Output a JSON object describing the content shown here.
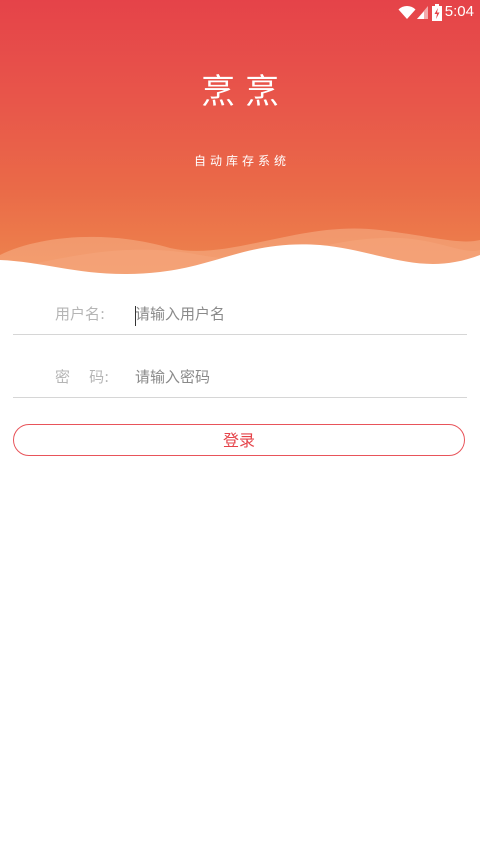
{
  "status_bar": {
    "time": "5:04",
    "icons": [
      "wifi-icon",
      "signal-icon",
      "battery-charging-icon"
    ]
  },
  "app": {
    "title": "烹烹",
    "subtitle": "自动库存系统"
  },
  "form": {
    "username": {
      "label": "用户名:",
      "placeholder": "请输入用户名",
      "value": ""
    },
    "password": {
      "label": "密    码:",
      "placeholder": "请输入密码",
      "value": ""
    },
    "login_label": "登录"
  },
  "colors": {
    "header_top": "#e54349",
    "header_bottom": "#ee8a4e",
    "accent": "#e54349"
  }
}
